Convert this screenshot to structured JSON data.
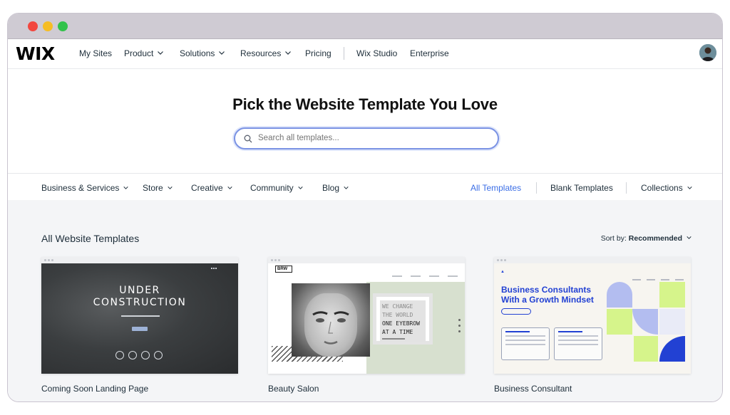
{
  "window": {
    "controls": [
      "close",
      "minimize",
      "maximize"
    ]
  },
  "topnav": {
    "logo": "WIX",
    "items": [
      {
        "label": "My Sites",
        "dropdown": false
      },
      {
        "label": "Product",
        "dropdown": true
      },
      {
        "label": "Solutions",
        "dropdown": true
      },
      {
        "label": "Resources",
        "dropdown": true
      },
      {
        "label": "Pricing",
        "dropdown": false
      },
      {
        "label": "Wix Studio",
        "dropdown": false
      },
      {
        "label": "Enterprise",
        "dropdown": false
      }
    ]
  },
  "hero": {
    "title": "Pick the Website Template You Love",
    "search_placeholder": "Search all templates..."
  },
  "categories": {
    "left": [
      {
        "label": "Business & Services"
      },
      {
        "label": "Store"
      },
      {
        "label": "Creative"
      },
      {
        "label": "Community"
      },
      {
        "label": "Blog"
      }
    ],
    "right": [
      {
        "label": "All Templates",
        "active": true
      },
      {
        "label": "Blank Templates"
      },
      {
        "label": "Collections"
      }
    ]
  },
  "gallery": {
    "title": "All Website Templates",
    "sort_prefix": "Sort by:",
    "sort_value": "Recommended",
    "cards": [
      {
        "label": "Coming Soon Landing Page",
        "preview_text": [
          "UNDER",
          "CONSTRUCTION"
        ]
      },
      {
        "label": "Beauty Salon",
        "preview_logo": "BRW",
        "preview_text": [
          "WE CHANGE",
          "THE WORLD",
          "ONE EYEBROW",
          "AT A TIME"
        ]
      },
      {
        "label": "Business Consultant",
        "preview_text": [
          "Business Consultants",
          "With a Growth Mindset"
        ]
      }
    ]
  },
  "colors": {
    "accent": "#3b6ee6",
    "consultant_blue": "#2241d3",
    "lime": "#d6f48b",
    "lavender": "#b3bdf0"
  }
}
